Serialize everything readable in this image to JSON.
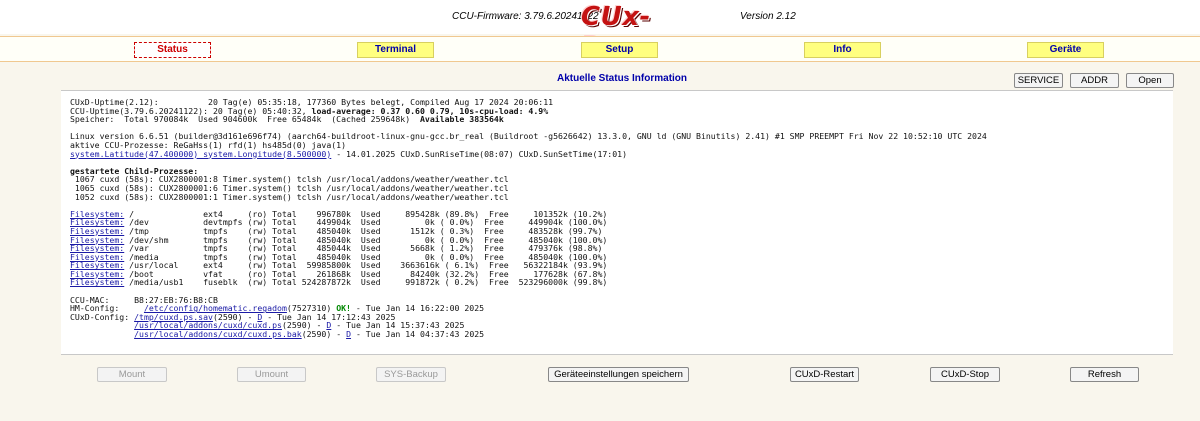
{
  "header": {
    "firmware": "CCU-Firmware: 3.79.6.20241122",
    "logo": "CUx-Daemon",
    "version": "Version 2.12"
  },
  "nav": {
    "status": "Status",
    "terminal": "Terminal",
    "setup": "Setup",
    "info": "Info",
    "geraete": "Geräte"
  },
  "status_title": "Aktuelle Status Information",
  "top_buttons": {
    "service": "SERVICE",
    "addr": "ADDR",
    "open": "Open"
  },
  "log": {
    "uptime_cuxd": "CUxD-Uptime(2.12):          20 Tag(e) 05:35:18, 177360 Bytes belegt, Compiled Aug 17 2024 20:06:11",
    "uptime_ccu_a": "CCU-Uptime(3.79.6.20241122): 20 Tag(e) 05:40:32, ",
    "uptime_ccu_b": "load-average: 0.37 0.60 0.79, 10s-cpu-load: 4.9%",
    "mem_a": "Speicher:  Total 970084k  Used 904600k  Free 65484k  (Cached 259648k)  ",
    "mem_b": "Available 383564k",
    "linux": "Linux version 6.6.51 (builder@3d161e696f74) (aarch64-buildroot-linux-gnu-gcc.br_real (Buildroot -g5626642) 13.3.0, GNU ld (GNU Binutils) 2.41) #1 SMP PREEMPT Fri Nov 22 10:52:10 UTC 2024",
    "prozesse": "aktive CCU-Prozesse: ReGaHss(1) rfd(1) hs485d(0) java(1)",
    "latlon_link": "system.Latitude(47.400000) system.Longitude(8.500000)",
    "latlon_rest": " - 14.01.2025 CUxD.SunRiseTime(08:07) CUxD.SunSetTime(17:01)",
    "child_title": "gestartete Child-Prozesse:",
    "child": [
      " 1067 cuxd (58s): CUX2800001:8 Timer.system() tclsh /usr/local/addons/weather/weather.tcl",
      " 1065 cuxd (58s): CUX2800001:6 Timer.system() tclsh /usr/local/addons/weather/weather.tcl",
      " 1052 cuxd (58s): CUX2800001:1 Timer.system() tclsh /usr/local/addons/weather/weather.tcl"
    ],
    "fs_label": "Filesystem:",
    "filesystems": [
      " /              ext4     (ro) Total    996780k  Used     895428k (89.8%)  Free     101352k (10.2%)",
      " /dev           devtmpfs (rw) Total    449904k  Used         0k ( 0.0%)  Free     449904k (100.0%)",
      " /tmp           tmpfs    (rw) Total    485040k  Used      1512k ( 0.3%)  Free     483528k (99.7%)",
      " /dev/shm       tmpfs    (rw) Total    485040k  Used         0k ( 0.0%)  Free     485040k (100.0%)",
      " /var           tmpfs    (rw) Total    485044k  Used      5668k ( 1.2%)  Free     479376k (98.8%)",
      " /media         tmpfs    (rw) Total    485040k  Used         0k ( 0.0%)  Free     485040k (100.0%)",
      " /usr/local     ext4     (rw) Total  59985800k  Used    3663616k ( 6.1%)  Free   56322184k (93.9%)",
      " /boot          vfat     (ro) Total    261868k  Used      84240k (32.2%)  Free     177628k (67.8%)",
      " /media/usb1    fuseblk  (rw) Total 524287872k  Used     991872k ( 0.2%)  Free  523296000k (99.8%)"
    ],
    "mac": "CCU-MAC:     B8:27:EB:76:B8:CB",
    "hm_label": "HM-Config:     ",
    "hm_link": "/etc/config/homematic.regadom",
    "hm_mid": "(7527310) ",
    "hm_ok": "OK!",
    "hm_end": " - Tue Jan 14 16:22:00 2025",
    "cuxd_label": "CUxD-Config: ",
    "cfg": [
      {
        "link": "/tmp/cuxd.ps.sav",
        "mid": "(2590) - ",
        "d": "D",
        "end": " - Tue Jan 14 17:12:43 2025"
      },
      {
        "link": "/usr/local/addons/cuxd/cuxd.ps",
        "mid": "(2590) - ",
        "d": "D",
        "end": " - Tue Jan 14 15:37:43 2025"
      },
      {
        "link": "/usr/local/addons/cuxd/cuxd.ps.bak",
        "mid": "(2590) - ",
        "d": "D",
        "end": " - Tue Jan 14 04:37:43 2025"
      }
    ]
  },
  "bottom_buttons": {
    "mount": "Mount",
    "umount": "Umount",
    "sys_backup": "SYS-Backup",
    "save": "Geräteeinstellungen speichern",
    "restart": "CUxD-Restart",
    "stop": "CUxD-Stop",
    "refresh": "Refresh"
  }
}
